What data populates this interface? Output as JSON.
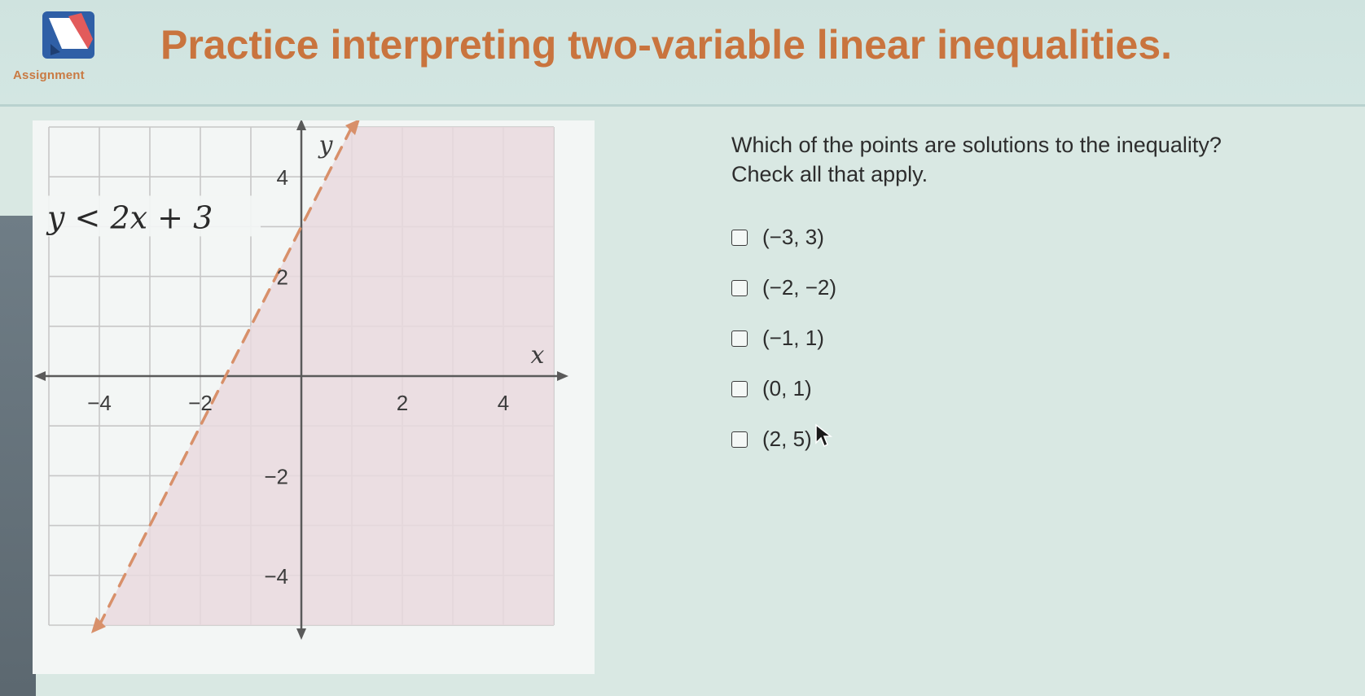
{
  "header": {
    "icon": "assignment-icon",
    "assignment_label": "Assignment",
    "title": "Practice interpreting two-variable linear inequalities."
  },
  "graph": {
    "inequality_label": "y < 2x + 3",
    "x_axis_label": "x",
    "y_axis_label": "y",
    "x_tick_labels": [
      "−4",
      "−2",
      "2",
      "4"
    ],
    "y_tick_labels": [
      "4",
      "2",
      "−2",
      "−4"
    ],
    "x_range": [
      -5,
      5
    ],
    "y_range": [
      -5,
      5
    ],
    "boundary": {
      "slope": 2,
      "intercept": 3,
      "style": "dashed"
    },
    "shaded_region": "above-boundary",
    "colors": {
      "shade": "#e9d9de",
      "boundary": "#d8906a",
      "grid": "#c7c7c7",
      "axis": "#5a5a5a",
      "tick_text": "#3c3c3c"
    }
  },
  "question": {
    "prompt_line1": "Which of the points are solutions to the inequality?",
    "prompt_line2": "Check all that apply.",
    "options": [
      {
        "label": "(−3, 3)",
        "checked": false
      },
      {
        "label": "(−2, −2)",
        "checked": false
      },
      {
        "label": "(−1, 1)",
        "checked": false
      },
      {
        "label": "(0, 1)",
        "checked": false
      },
      {
        "label": "(2, 5)",
        "checked": false
      }
    ]
  },
  "colors": {
    "accent": "#c9743e",
    "background": "#d9e8e3",
    "panel": "#f3f6f5"
  }
}
